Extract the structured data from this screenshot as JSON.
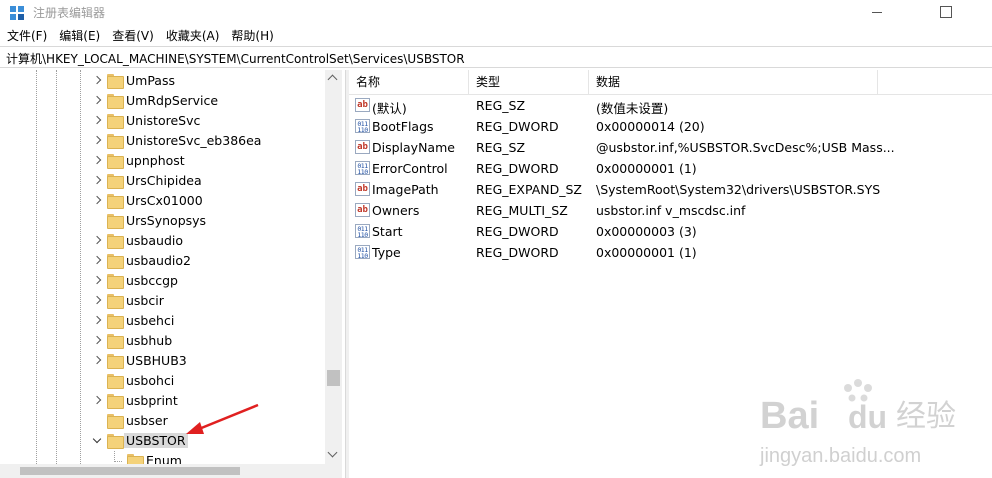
{
  "window": {
    "title": "注册表编辑器"
  },
  "menu": [
    "文件(F)",
    "编辑(E)",
    "查看(V)",
    "收藏夹(A)",
    "帮助(H)"
  ],
  "address": "计算机\\HKEY_LOCAL_MACHINE\\SYSTEM\\CurrentControlSet\\Services\\USBSTOR",
  "tree": [
    {
      "label": "UmPass",
      "expandable": true
    },
    {
      "label": "UmRdpService",
      "expandable": true
    },
    {
      "label": "UnistoreSvc",
      "expandable": true
    },
    {
      "label": "UnistoreSvc_eb386ea",
      "expandable": true
    },
    {
      "label": "upnphost",
      "expandable": true
    },
    {
      "label": "UrsChipidea",
      "expandable": true
    },
    {
      "label": "UrsCx01000",
      "expandable": true
    },
    {
      "label": "UrsSynopsys",
      "expandable": false
    },
    {
      "label": "usbaudio",
      "expandable": true
    },
    {
      "label": "usbaudio2",
      "expandable": true
    },
    {
      "label": "usbccgp",
      "expandable": true
    },
    {
      "label": "usbcir",
      "expandable": true
    },
    {
      "label": "usbehci",
      "expandable": true
    },
    {
      "label": "usbhub",
      "expandable": true
    },
    {
      "label": "USBHUB3",
      "expandable": true
    },
    {
      "label": "usbohci",
      "expandable": false
    },
    {
      "label": "usbprint",
      "expandable": true
    },
    {
      "label": "usbser",
      "expandable": false
    },
    {
      "label": "USBSTOR",
      "expandable": true,
      "expanded": true,
      "selected": true
    },
    {
      "label": "Enum",
      "expandable": false,
      "child": true
    }
  ],
  "values_header": {
    "name": "名称",
    "type": "类型",
    "data": "数据"
  },
  "values": [
    {
      "icon": "string-value-icon",
      "name": "(默认)",
      "type": "REG_SZ",
      "data": "(数值未设置)"
    },
    {
      "icon": "binary-value-icon",
      "name": "BootFlags",
      "type": "REG_DWORD",
      "data": "0x00000014 (20)"
    },
    {
      "icon": "string-value-icon",
      "name": "DisplayName",
      "type": "REG_SZ",
      "data": "@usbstor.inf,%USBSTOR.SvcDesc%;USB Mass..."
    },
    {
      "icon": "binary-value-icon",
      "name": "ErrorControl",
      "type": "REG_DWORD",
      "data": "0x00000001 (1)"
    },
    {
      "icon": "string-value-icon",
      "name": "ImagePath",
      "type": "REG_EXPAND_SZ",
      "data": "\\SystemRoot\\System32\\drivers\\USBSTOR.SYS"
    },
    {
      "icon": "string-value-icon",
      "name": "Owners",
      "type": "REG_MULTI_SZ",
      "data": "usbstor.inf v_mscdsc.inf"
    },
    {
      "icon": "binary-value-icon",
      "name": "Start",
      "type": "REG_DWORD",
      "data": "0x00000003 (3)"
    },
    {
      "icon": "binary-value-icon",
      "name": "Type",
      "type": "REG_DWORD",
      "data": "0x00000001 (1)"
    }
  ],
  "watermark": {
    "line1": "Bai",
    "line2": "经验",
    "url": "jingyan.baidu.com"
  },
  "colors": {
    "annotation_arrow": "#e02020",
    "selection": "#d9d9d9",
    "folder": "#f4d27a"
  }
}
